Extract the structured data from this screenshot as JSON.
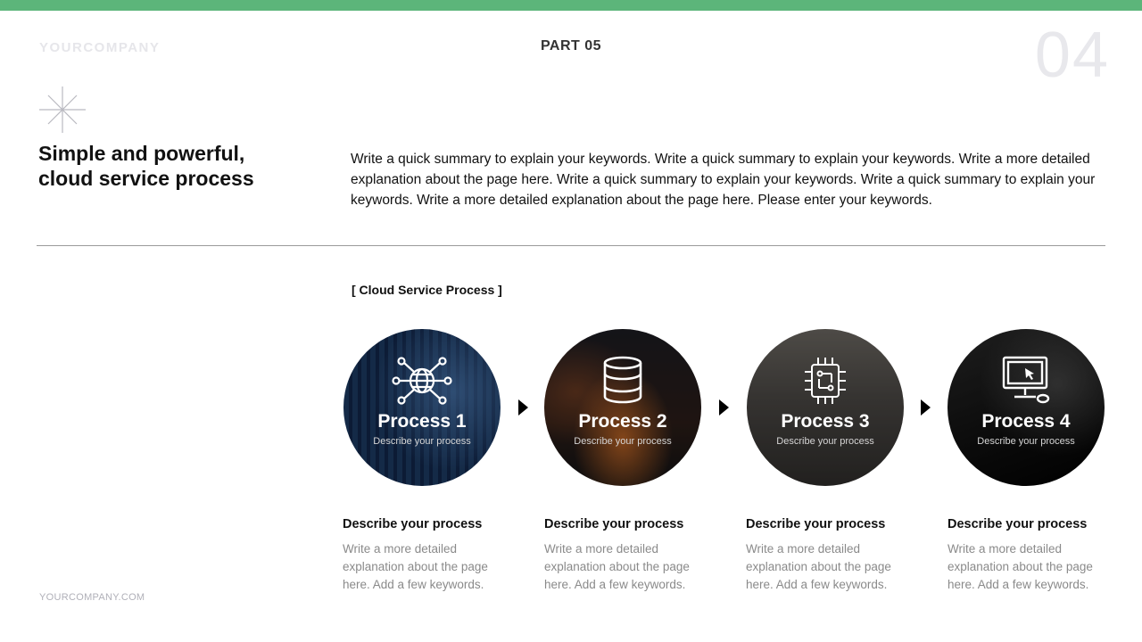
{
  "header": {
    "logo": "YOURCOMPANY",
    "part": "PART 05",
    "page_number": "04"
  },
  "intro": {
    "headline_line1": "Simple and powerful,",
    "headline_line2": "cloud service process",
    "summary": "Write a quick summary to explain your keywords. Write a quick summary to explain your keywords. Write a more detailed explanation about the page here.  Write a quick summary to explain your keywords. Write a quick summary to explain your keywords. Write a more detailed explanation about the page here. Please enter your keywords."
  },
  "section": {
    "title": "[ Cloud Service Process ]"
  },
  "steps": [
    {
      "title": "Process 1",
      "subtitle": "Describe your process",
      "icon": "network-globe-icon",
      "desc_title": "Describe your process",
      "desc_body": "Write a more detailed explanation about the page here. Add a few keywords."
    },
    {
      "title": "Process 2",
      "subtitle": "Describe your process",
      "icon": "database-icon",
      "desc_title": "Describe your process",
      "desc_body": "Write a more detailed explanation about the page here. Add a few keywords."
    },
    {
      "title": "Process 3",
      "subtitle": "Describe your process",
      "icon": "circuit-chip-icon",
      "desc_title": "Describe your process",
      "desc_body": "Write a more detailed explanation about the page here. Add a few keywords."
    },
    {
      "title": "Process 4",
      "subtitle": "Describe your process",
      "icon": "computer-monitor-icon",
      "desc_title": "Describe your process",
      "desc_body": "Write a more detailed explanation about the page here. Add a few keywords."
    }
  ],
  "footer": {
    "url": "YOURCOMPANY.COM"
  },
  "colors": {
    "accent": "#5cb57a",
    "text": "#111111",
    "muted": "#8a8a8a"
  }
}
